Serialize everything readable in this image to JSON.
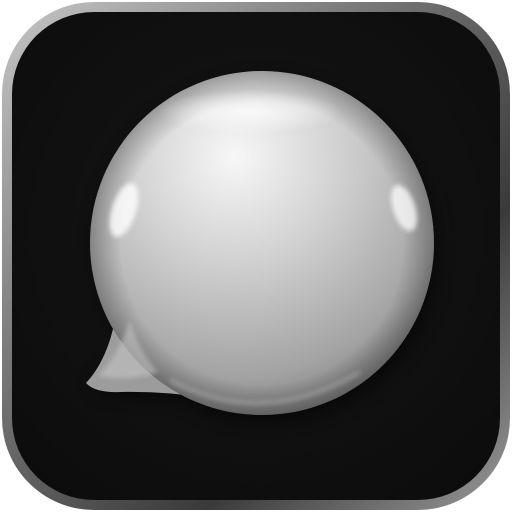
{
  "app_icon": {
    "icon": "speech-bubble-icon",
    "style": "glossy silver speech bubble on black rounded-square tile",
    "colors": {
      "tile_background": "#121212",
      "tile_bezel_light": "#bdbdbd",
      "tile_bezel_dark": "#3a3a3a",
      "bubble_highlight": "#f4f4f4",
      "bubble_mid": "#b9b9b9",
      "bubble_shadow": "#6e6e6e"
    }
  }
}
